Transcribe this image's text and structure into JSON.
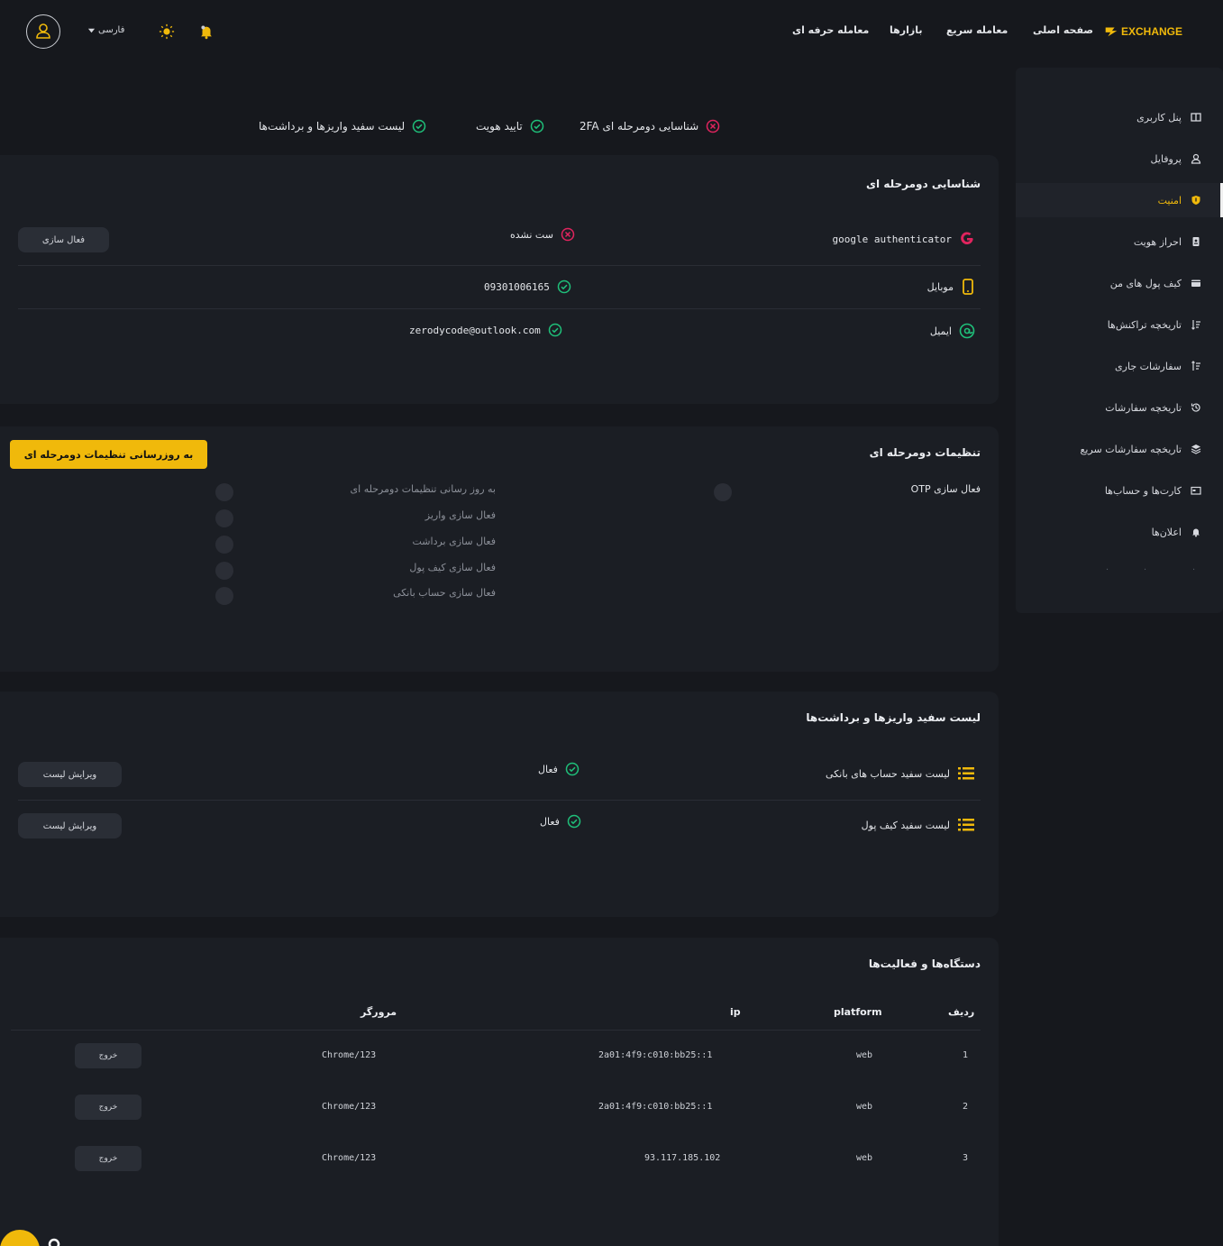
{
  "header": {
    "brand": "EXCHANGE",
    "nav": [
      "صفحه اصلی",
      "معامله سریع",
      "بازارها",
      "معامله حرفه ای"
    ],
    "language": "فارسی",
    "icons": [
      "user-icon",
      "sun-icon",
      "bell-icon",
      "chevron-down-icon"
    ]
  },
  "sidebar": {
    "items": [
      {
        "label": "پنل کاربری",
        "icon": "dashboard-icon"
      },
      {
        "label": "پروفایل",
        "icon": "user-icon"
      },
      {
        "label": "امنیت",
        "icon": "shield-icon",
        "active": true
      },
      {
        "label": "احراز هویت",
        "icon": "id-card-icon"
      },
      {
        "label": "کیف پول های من",
        "icon": "wallet-icon"
      },
      {
        "label": "تاریخچه تراکنش‌ها",
        "icon": "sort-icon"
      },
      {
        "label": "سفارشات جاری",
        "icon": "sort-icon"
      },
      {
        "label": "تاریخچه سفارشات",
        "icon": "history-icon"
      },
      {
        "label": "تاریخچه سفارشات سریع",
        "icon": "layers-icon"
      },
      {
        "label": "کارت‌ها و حساب‌ها",
        "icon": "card-icon"
      },
      {
        "label": "اعلان‌ها",
        "icon": "bell-icon"
      }
    ],
    "dots": [
      "·",
      "·",
      "·"
    ]
  },
  "steps": [
    {
      "label": "شناسایی دومرحله ای 2FA",
      "status": "error"
    },
    {
      "label": "تایید هویت",
      "status": "ok"
    },
    {
      "label": "لیست سفید واریزها و برداشت‌ها",
      "status": "ok"
    }
  ],
  "twofa": {
    "title": "شناسایی دومرحله ای",
    "rows": [
      {
        "label": "google authenticator",
        "value": "ست نشده",
        "status": "error",
        "button": "فعال سازی"
      },
      {
        "label": "موبایل",
        "value": "09301006165",
        "status": "ok"
      },
      {
        "label": "ایمیل",
        "value": "zerodycode@outlook.com",
        "status": "ok"
      }
    ]
  },
  "settings": {
    "title": "تنظیمات دومرحله ای",
    "update_button": "به روزرسانی تنظیمات دومرحله ای",
    "otp_label": "فعال سازی OTP",
    "options": [
      "به روز رسانی تنظیمات دومرحله ای",
      "فعال سازی واریز",
      "فعال سازی برداشت",
      "فعال سازی کیف پول",
      "فعال سازی حساب بانکی"
    ]
  },
  "whitelist": {
    "title": "لیست سفید واریزها و برداشت‌ها",
    "rows": [
      {
        "label": "لیست سفید حساب های بانکی",
        "status": "فعال",
        "button": "ویرایش لیست"
      },
      {
        "label": "لیست سفید کیف پول",
        "status": "فعال",
        "button": "ویرایش لیست"
      }
    ]
  },
  "devices": {
    "title": "دستگاه‌ها و فعالیت‌ها",
    "headers": {
      "row": "ردیف",
      "platform": "platform",
      "ip": "ip",
      "browser": "مرورگر"
    },
    "rows": [
      {
        "n": "1",
        "platform": "web",
        "ip": "2a01:4f9:c010:bb25::1",
        "browser": "Chrome/123",
        "button": "خروج"
      },
      {
        "n": "2",
        "platform": "web",
        "ip": "2a01:4f9:c010:bb25::1",
        "browser": "Chrome/123",
        "button": "خروج"
      },
      {
        "n": "3",
        "platform": "web",
        "ip": "93.117.185.102",
        "browser": "Chrome/123",
        "button": "خروج"
      }
    ]
  },
  "colors": {
    "accent": "#f0b90b",
    "ok": "#1fc07a",
    "error": "#e0245e",
    "bg": "#16181d",
    "card": "#1b1e24"
  }
}
